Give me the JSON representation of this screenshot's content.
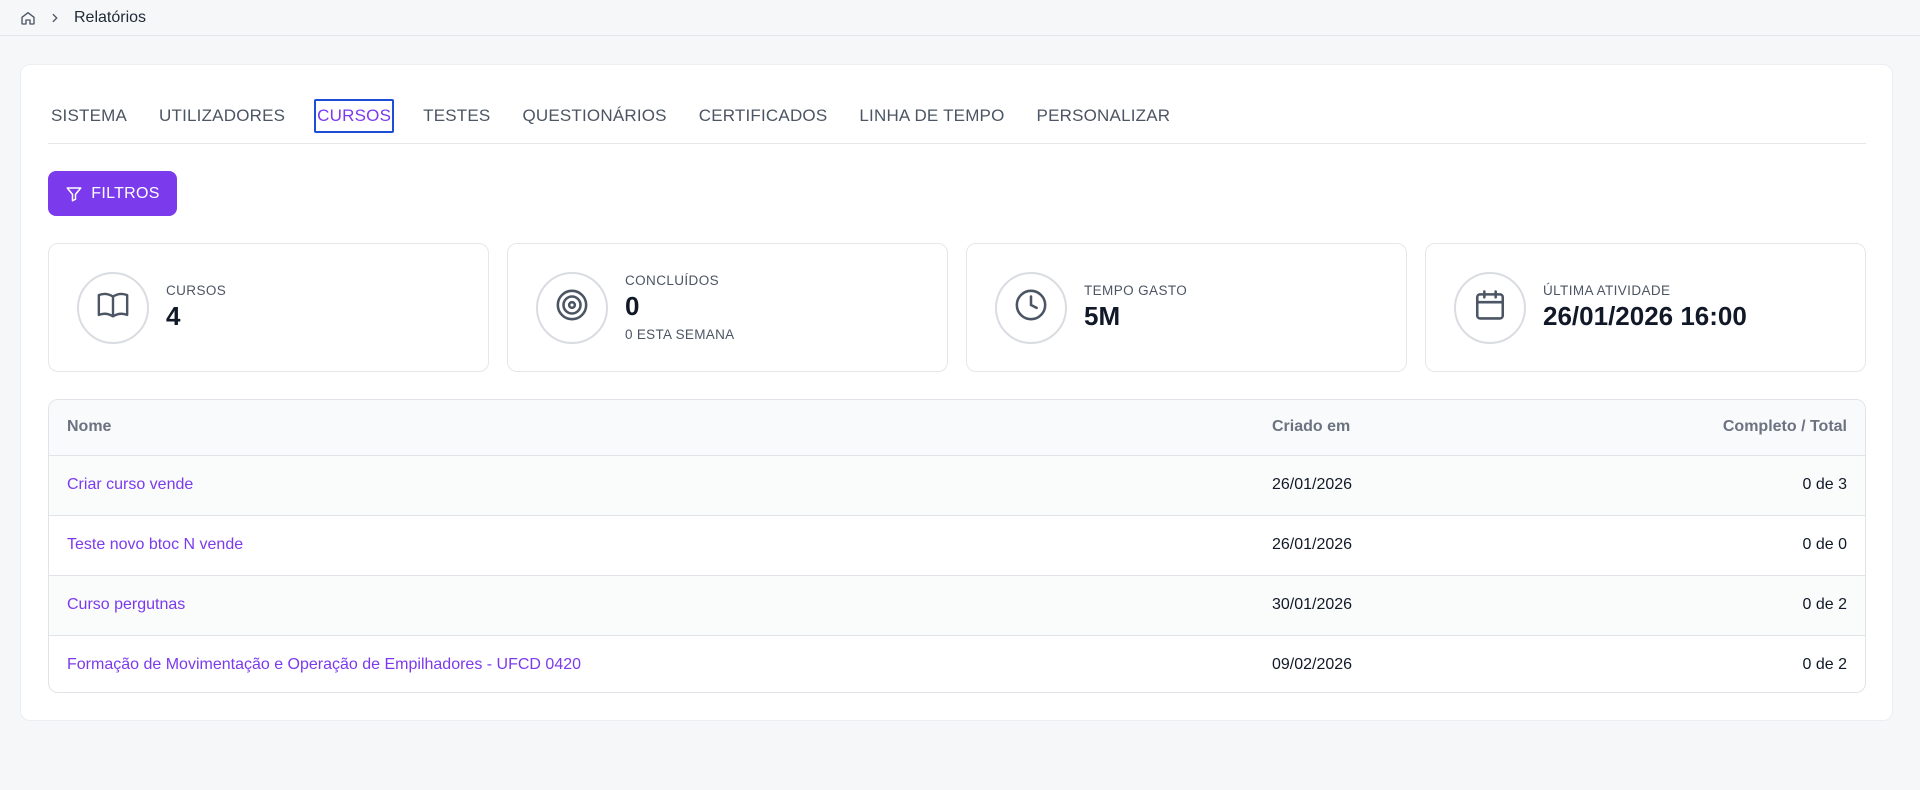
{
  "breadcrumb": {
    "home_icon": "home-icon",
    "separator_icon": "chevron-right-icon",
    "current": "Relatórios"
  },
  "tabs": [
    {
      "label": "SISTEMA",
      "active": false
    },
    {
      "label": "UTILIZADORES",
      "active": false
    },
    {
      "label": "CURSOS",
      "active": true
    },
    {
      "label": "TESTES",
      "active": false
    },
    {
      "label": "QUESTIONÁRIOS",
      "active": false
    },
    {
      "label": "CERTIFICADOS",
      "active": false
    },
    {
      "label": "LINHA DE TEMPO",
      "active": false
    },
    {
      "label": "PERSONALIZAR",
      "active": false
    }
  ],
  "filter_button": {
    "label": "FILTROS",
    "icon": "funnel-icon"
  },
  "stats": [
    {
      "icon": "book-open-icon",
      "label": "CURSOS",
      "value": "4",
      "sub": ""
    },
    {
      "icon": "target-icon",
      "label": "CONCLUÍDOS",
      "value": "0",
      "sub": "0 ESTA SEMANA"
    },
    {
      "icon": "clock-icon",
      "label": "TEMPO GASTO",
      "value": "5M",
      "sub": ""
    },
    {
      "icon": "calendar-icon",
      "label": "ÚLTIMA ATIVIDADE",
      "value": "26/01/2026 16:00",
      "sub": ""
    }
  ],
  "table": {
    "headers": {
      "name": "Nome",
      "created": "Criado em",
      "progress": "Completo / Total"
    },
    "rows": [
      {
        "name": "Criar curso vende",
        "created": "26/01/2026",
        "progress": "0 de 3"
      },
      {
        "name": "Teste novo btoc N vende",
        "created": "26/01/2026",
        "progress": "0 de 0"
      },
      {
        "name": "Curso pergutnas",
        "created": "30/01/2026",
        "progress": "0 de 2"
      },
      {
        "name": "Formação de Movimentação e Operação de Empilhadores - UFCD 0420",
        "created": "09/02/2026",
        "progress": "0 de 2"
      }
    ]
  },
  "colors": {
    "accent": "#7c3aed",
    "focus_outline": "#1d4ed8"
  }
}
